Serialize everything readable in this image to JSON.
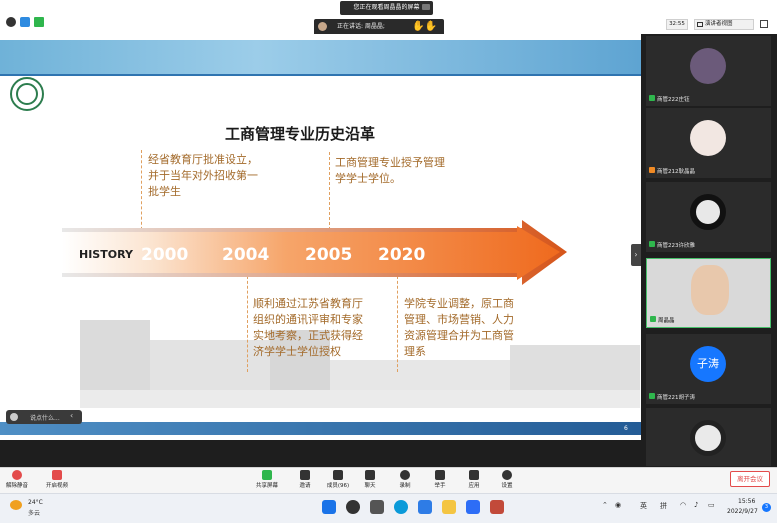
{
  "top_bar": {
    "share_banner": "您正在观看周晶晶的屏幕",
    "speaking": "正在讲话: 周晶晶;",
    "timer": "32:55",
    "view_button": "演讲者视图"
  },
  "slide": {
    "university": "南通大學",
    "title": "工商管理专业历史沿革",
    "history_label": "HISTORY",
    "years": [
      "2000",
      "2004",
      "2005",
      "2020"
    ],
    "notes": {
      "y2000": "经省教育厅批准设立，并于当年对外招收第一批学生",
      "y2005": "工商管理专业授予管理学学士学位。",
      "y2004": "顺利通过江苏省教育厅组织的通讯评审和专家实地考察，正式获得经济学学士学位授权",
      "y2020": "学院专业调整，原工商管理、市场营销、人力资源管理合并为工商管理系"
    },
    "page_number": "6"
  },
  "chat": {
    "placeholder": "说点什么..."
  },
  "participants": [
    {
      "name": "商管222庄钰"
    },
    {
      "name": "商管212耿晶晶"
    },
    {
      "name": "商管223许欣雅"
    },
    {
      "name": "周晶晶"
    },
    {
      "name": "商管221胡子涛",
      "avatar_text": "子涛"
    },
    {
      "name": ""
    }
  ],
  "toolbar": {
    "left": [
      {
        "label": "解除静音",
        "icon": "mic-off-icon"
      },
      {
        "label": "开启视频",
        "icon": "video-off-icon"
      }
    ],
    "center": [
      {
        "label": "共享屏幕",
        "icon": "share-screen-icon"
      },
      {
        "label": "邀请",
        "icon": "invite-icon"
      },
      {
        "label": "成员(96)",
        "icon": "members-icon"
      },
      {
        "label": "聊天",
        "icon": "chat-icon"
      },
      {
        "label": "录制",
        "icon": "record-icon"
      },
      {
        "label": "举手",
        "icon": "raise-hand-icon"
      },
      {
        "label": "应用",
        "icon": "apps-icon"
      },
      {
        "label": "设置",
        "icon": "settings-icon"
      }
    ],
    "end_meeting": "离开会议"
  },
  "taskbar": {
    "weather_temp": "24°C",
    "weather_desc": "多云",
    "tray_lang": "英",
    "tray_ime": "拼",
    "time": "15:56",
    "date": "2022/9/27",
    "notifications": "3"
  },
  "colors": {
    "accent_orange": "#f0772a",
    "note_text": "#a36a2a",
    "speaking_ring": "#47c06a",
    "end_button": "#e34b4b"
  }
}
